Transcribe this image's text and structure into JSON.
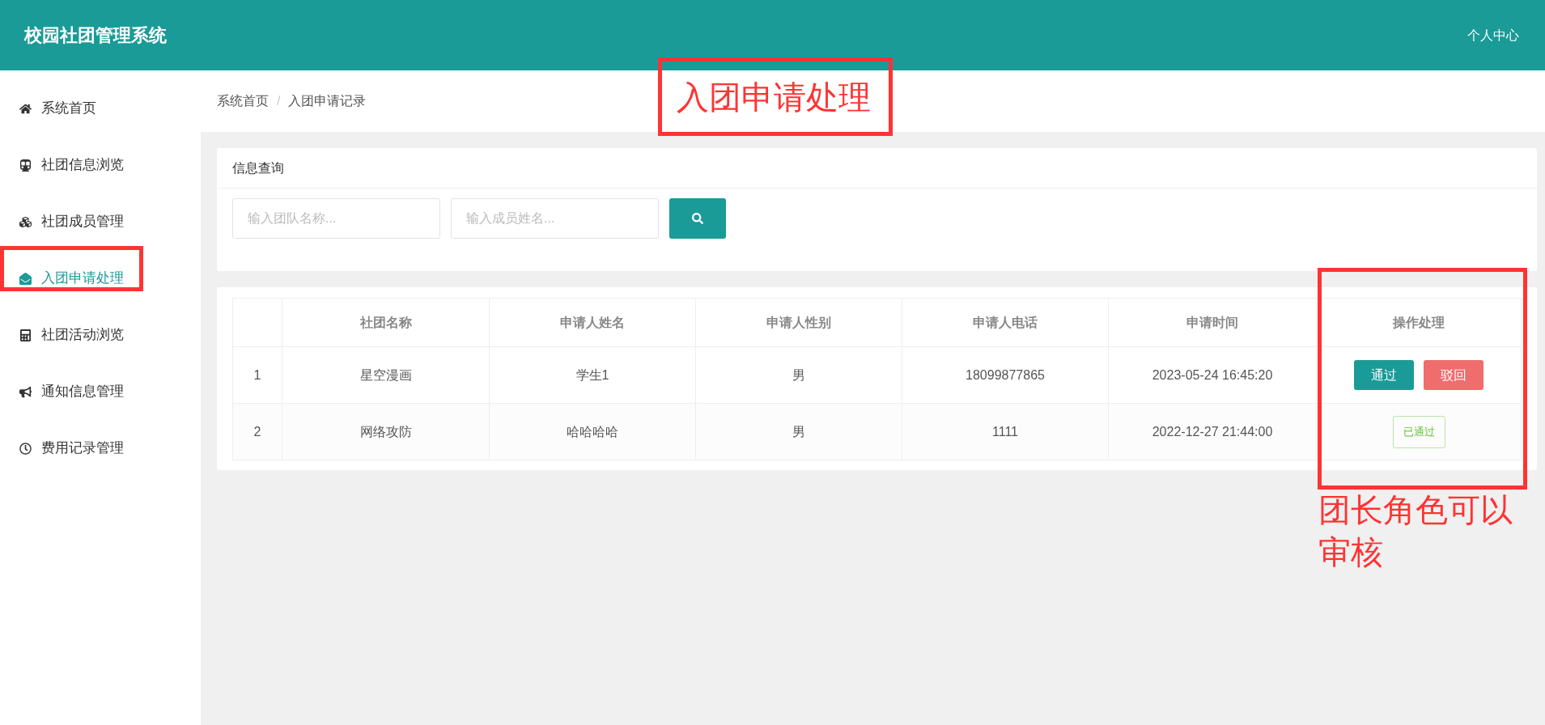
{
  "header": {
    "title": "校园社团管理系统",
    "user_menu": "个人中心"
  },
  "sidebar": {
    "items": [
      {
        "label": "系统首页",
        "selected": false
      },
      {
        "label": "社团信息浏览",
        "selected": false
      },
      {
        "label": "社团成员管理",
        "selected": false
      },
      {
        "label": "入团申请处理",
        "selected": true
      },
      {
        "label": "社团活动浏览",
        "selected": false
      },
      {
        "label": "通知信息管理",
        "selected": false
      },
      {
        "label": "费用记录管理",
        "selected": false
      }
    ]
  },
  "breadcrumb": [
    "系统首页",
    "入团申请记录"
  ],
  "breadcrumb_separator": "/",
  "search_card": {
    "title": "信息查询",
    "fields": [
      {
        "placeholder": "输入团队名称..."
      },
      {
        "placeholder": "输入成员姓名..."
      }
    ]
  },
  "table": {
    "columns": [
      "",
      "社团名称",
      "申请人姓名",
      "申请人性别",
      "申请人电话",
      "申请时间",
      "操作处理"
    ],
    "rows": [
      {
        "cells": [
          "1",
          "星空漫画",
          "学生1",
          "男",
          "18099877865",
          "2023-05-24 16:45:20"
        ],
        "action": {
          "kind": "buttons",
          "buttons": [
            "通过",
            "驳回"
          ]
        }
      },
      {
        "cells": [
          "2",
          "网络攻防",
          "哈哈哈哈",
          "男",
          "1111",
          "2022-12-27 21:44:00"
        ],
        "action": {
          "kind": "tag",
          "text": "已通过"
        }
      }
    ]
  },
  "annotations": [
    {
      "kind": "callout",
      "text": "入团申请处理"
    },
    {
      "kind": "box"
    },
    {
      "kind": "box"
    },
    {
      "kind": "note",
      "text": "团长角色可以审核"
    }
  ]
}
